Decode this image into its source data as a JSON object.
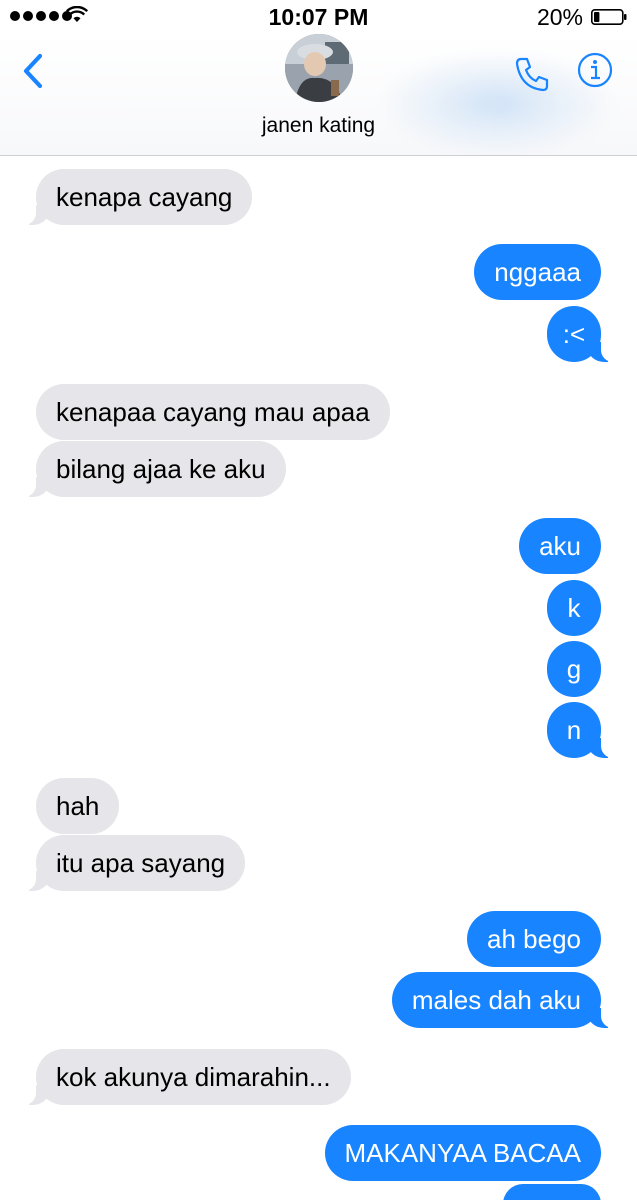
{
  "status_bar": {
    "time": "10:07 PM",
    "battery_percent": "20%",
    "signal_bars": 5,
    "battery_level": 0.2
  },
  "header": {
    "contact_name": "janen kating",
    "back_icon": "chevron-left-icon",
    "call_icon": "phone-icon",
    "info_icon": "info-icon",
    "accent_color": "#1884ff"
  },
  "messages": [
    {
      "side": "received",
      "text": "kenapa cayang"
    },
    {
      "side": "sent",
      "text": "nggaaa"
    },
    {
      "side": "sent",
      "text": ":<"
    },
    {
      "side": "received",
      "text": "kenapaa cayang mau apaa"
    },
    {
      "side": "received",
      "text": "bilang ajaa ke aku"
    },
    {
      "side": "sent",
      "text": "aku"
    },
    {
      "side": "sent",
      "text": "k"
    },
    {
      "side": "sent",
      "text": "g"
    },
    {
      "side": "sent",
      "text": "n"
    },
    {
      "side": "received",
      "text": "hah"
    },
    {
      "side": "received",
      "text": "itu apa sayang"
    },
    {
      "side": "sent",
      "text": "ah bego"
    },
    {
      "side": "sent",
      "text": "males dah aku"
    },
    {
      "side": "received",
      "text": "kok akunya dimarahin..."
    },
    {
      "side": "sent",
      "text": "MAKANYAA BACAA"
    }
  ],
  "colors": {
    "sent_bubble": "#1884ff",
    "received_bubble": "#e5e5ea"
  }
}
